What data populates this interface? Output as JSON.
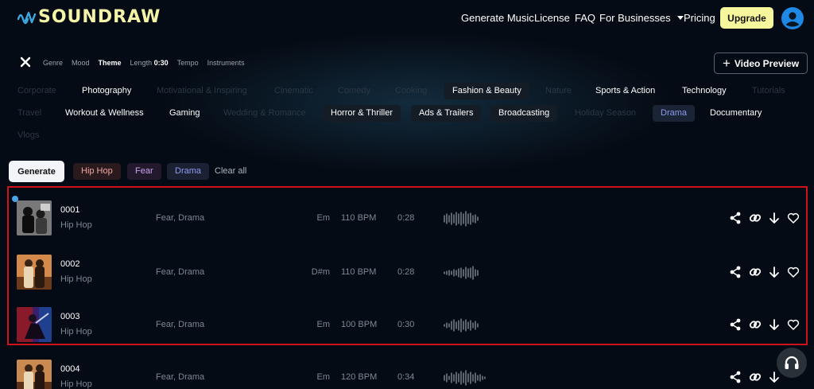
{
  "brand": {
    "name": "SOUNDRAW",
    "color": "#f4f4a8"
  },
  "nav": {
    "generate_music": "Generate Music",
    "license": "License",
    "faq": "FAQ",
    "for_businesses": "For Businesses",
    "pricing": "Pricing",
    "upgrade": "Upgrade"
  },
  "filters": {
    "tabs": [
      "Genre",
      "Mood",
      "Theme",
      "Length",
      "Tempo",
      "Instruments"
    ],
    "active_tab": "Theme",
    "length_value": "0:30"
  },
  "video_preview": {
    "label": "Video Preview"
  },
  "themes": [
    {
      "label": "Corporate",
      "state": "dim"
    },
    {
      "label": "Photography",
      "state": "on"
    },
    {
      "label": "Motivational & Inspiring",
      "state": "dim"
    },
    {
      "label": "Cinematic",
      "state": "dim"
    },
    {
      "label": "Comedy",
      "state": "dim"
    },
    {
      "label": "Cooking",
      "state": "dim"
    },
    {
      "label": "Fashion & Beauty",
      "state": "pill"
    },
    {
      "label": "Nature",
      "state": "dim"
    },
    {
      "label": "Sports & Action",
      "state": "on"
    },
    {
      "label": "Technology",
      "state": "on"
    },
    {
      "label": "Tutorials",
      "state": "dim"
    },
    {
      "label": "Travel",
      "state": "dim"
    },
    {
      "label": "Workout & Wellness",
      "state": "on"
    },
    {
      "label": "Gaming",
      "state": "on"
    },
    {
      "label": "Wedding & Romance",
      "state": "dim"
    },
    {
      "label": "Horror & Thriller",
      "state": "pill"
    },
    {
      "label": "Ads & Trailers",
      "state": "pill"
    },
    {
      "label": "Broadcasting",
      "state": "pill"
    },
    {
      "label": "Holiday Season",
      "state": "dim"
    },
    {
      "label": "Drama",
      "state": "selected"
    },
    {
      "label": "Documentary",
      "state": "on"
    },
    {
      "label": "Vlogs",
      "state": "dim"
    }
  ],
  "actions": {
    "generate": "Generate",
    "clear_all": "Clear all"
  },
  "selected_tags": [
    {
      "label": "Hip Hop",
      "kind": "genre"
    },
    {
      "label": "Fear",
      "kind": "mood"
    },
    {
      "label": "Drama",
      "kind": "theme"
    }
  ],
  "tracks": [
    {
      "title": "0001",
      "genre": "Hip Hop",
      "moods": "Fear, Drama",
      "key": "Em",
      "bpm": "110 BPM",
      "duration": "0:28",
      "playing": true
    },
    {
      "title": "0002",
      "genre": "Hip Hop",
      "moods": "Fear, Drama",
      "key": "D#m",
      "bpm": "110 BPM",
      "duration": "0:28",
      "playing": false
    },
    {
      "title": "0003",
      "genre": "Hip Hop",
      "moods": "Fear, Drama",
      "key": "Em",
      "bpm": "100 BPM",
      "duration": "0:30",
      "playing": false
    },
    {
      "title": "0004",
      "genre": "Hip Hop",
      "moods": "Fear, Drama",
      "key": "Em",
      "bpm": "120 BPM",
      "duration": "0:34",
      "playing": false
    }
  ],
  "icons": {
    "close": "close-icon",
    "avatar": "user-avatar-icon",
    "share": "share-icon",
    "link": "link-icon",
    "download": "download-arrow-icon",
    "favorite": "heart-icon",
    "support": "headset-icon"
  },
  "colors": {
    "background": "#050b14",
    "upgrade_button": "#f6f79c",
    "accent_blue": "#1e88e5",
    "highlight_border": "#d0131a"
  }
}
